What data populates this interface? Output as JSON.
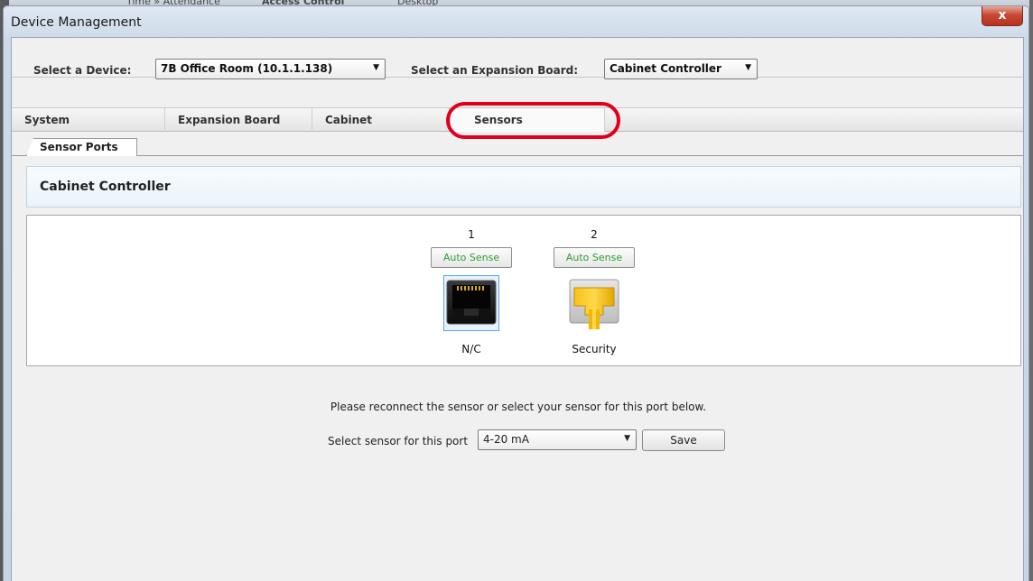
{
  "background_app": {
    "tabs": [
      "Time » Attendance",
      "Access Control",
      "Desktop"
    ]
  },
  "window": {
    "title": "Device Management",
    "close_label": "x"
  },
  "selectors": {
    "device_label": "Select a Device:",
    "device_value": "7B Office Room (10.1.1.138)",
    "board_label": "Select an Expansion Board:",
    "board_value": "Cabinet Controller"
  },
  "tabs": [
    {
      "label": "System",
      "active": false
    },
    {
      "label": "Expansion Board",
      "active": false
    },
    {
      "label": "Cabinet",
      "active": false
    },
    {
      "label": "Sensors",
      "active": true
    }
  ],
  "sub_tab": {
    "label": "Sensor Ports"
  },
  "panel": {
    "title": "Cabinet Controller"
  },
  "ports": [
    {
      "number": "1",
      "auto_label": "Auto Sense",
      "name": "N/C",
      "selected": true,
      "icon": "ethernet-jack-icon"
    },
    {
      "number": "2",
      "auto_label": "Auto Sense",
      "name": "Security",
      "selected": false,
      "icon": "yellow-cable-plug-icon"
    }
  ],
  "message": "Please reconnect the sensor or select your sensor for this port below.",
  "sensor_select": {
    "label": "Select sensor for this port",
    "value": "4-20 mA"
  },
  "save_label": "Save",
  "colors": {
    "highlight": "#e0001b",
    "auto_sense_text": "#2e9e2e",
    "selected_port_border": "#5aa5e8"
  }
}
